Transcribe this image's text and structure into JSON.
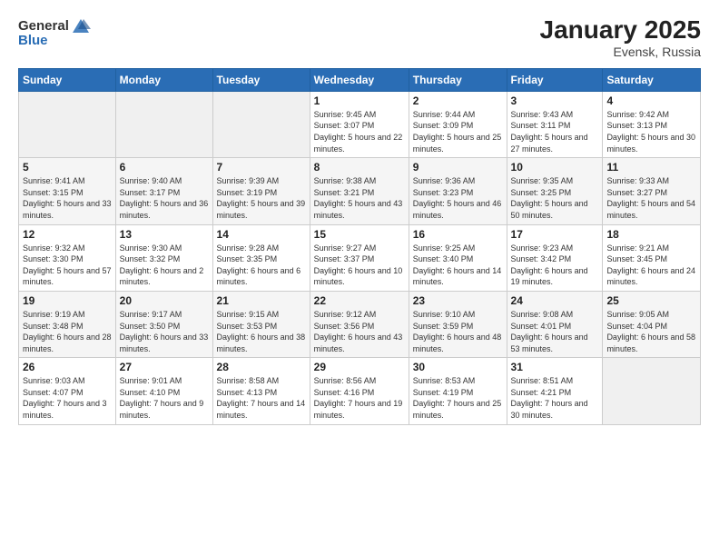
{
  "logo": {
    "general": "General",
    "blue": "Blue"
  },
  "header": {
    "month": "January 2025",
    "location": "Evensk, Russia"
  },
  "weekdays": [
    "Sunday",
    "Monday",
    "Tuesday",
    "Wednesday",
    "Thursday",
    "Friday",
    "Saturday"
  ],
  "weeks": [
    [
      {
        "day": "",
        "info": ""
      },
      {
        "day": "",
        "info": ""
      },
      {
        "day": "",
        "info": ""
      },
      {
        "day": "1",
        "info": "Sunrise: 9:45 AM\nSunset: 3:07 PM\nDaylight: 5 hours and 22 minutes."
      },
      {
        "day": "2",
        "info": "Sunrise: 9:44 AM\nSunset: 3:09 PM\nDaylight: 5 hours and 25 minutes."
      },
      {
        "day": "3",
        "info": "Sunrise: 9:43 AM\nSunset: 3:11 PM\nDaylight: 5 hours and 27 minutes."
      },
      {
        "day": "4",
        "info": "Sunrise: 9:42 AM\nSunset: 3:13 PM\nDaylight: 5 hours and 30 minutes."
      }
    ],
    [
      {
        "day": "5",
        "info": "Sunrise: 9:41 AM\nSunset: 3:15 PM\nDaylight: 5 hours and 33 minutes."
      },
      {
        "day": "6",
        "info": "Sunrise: 9:40 AM\nSunset: 3:17 PM\nDaylight: 5 hours and 36 minutes."
      },
      {
        "day": "7",
        "info": "Sunrise: 9:39 AM\nSunset: 3:19 PM\nDaylight: 5 hours and 39 minutes."
      },
      {
        "day": "8",
        "info": "Sunrise: 9:38 AM\nSunset: 3:21 PM\nDaylight: 5 hours and 43 minutes."
      },
      {
        "day": "9",
        "info": "Sunrise: 9:36 AM\nSunset: 3:23 PM\nDaylight: 5 hours and 46 minutes."
      },
      {
        "day": "10",
        "info": "Sunrise: 9:35 AM\nSunset: 3:25 PM\nDaylight: 5 hours and 50 minutes."
      },
      {
        "day": "11",
        "info": "Sunrise: 9:33 AM\nSunset: 3:27 PM\nDaylight: 5 hours and 54 minutes."
      }
    ],
    [
      {
        "day": "12",
        "info": "Sunrise: 9:32 AM\nSunset: 3:30 PM\nDaylight: 5 hours and 57 minutes."
      },
      {
        "day": "13",
        "info": "Sunrise: 9:30 AM\nSunset: 3:32 PM\nDaylight: 6 hours and 2 minutes."
      },
      {
        "day": "14",
        "info": "Sunrise: 9:28 AM\nSunset: 3:35 PM\nDaylight: 6 hours and 6 minutes."
      },
      {
        "day": "15",
        "info": "Sunrise: 9:27 AM\nSunset: 3:37 PM\nDaylight: 6 hours and 10 minutes."
      },
      {
        "day": "16",
        "info": "Sunrise: 9:25 AM\nSunset: 3:40 PM\nDaylight: 6 hours and 14 minutes."
      },
      {
        "day": "17",
        "info": "Sunrise: 9:23 AM\nSunset: 3:42 PM\nDaylight: 6 hours and 19 minutes."
      },
      {
        "day": "18",
        "info": "Sunrise: 9:21 AM\nSunset: 3:45 PM\nDaylight: 6 hours and 24 minutes."
      }
    ],
    [
      {
        "day": "19",
        "info": "Sunrise: 9:19 AM\nSunset: 3:48 PM\nDaylight: 6 hours and 28 minutes."
      },
      {
        "day": "20",
        "info": "Sunrise: 9:17 AM\nSunset: 3:50 PM\nDaylight: 6 hours and 33 minutes."
      },
      {
        "day": "21",
        "info": "Sunrise: 9:15 AM\nSunset: 3:53 PM\nDaylight: 6 hours and 38 minutes."
      },
      {
        "day": "22",
        "info": "Sunrise: 9:12 AM\nSunset: 3:56 PM\nDaylight: 6 hours and 43 minutes."
      },
      {
        "day": "23",
        "info": "Sunrise: 9:10 AM\nSunset: 3:59 PM\nDaylight: 6 hours and 48 minutes."
      },
      {
        "day": "24",
        "info": "Sunrise: 9:08 AM\nSunset: 4:01 PM\nDaylight: 6 hours and 53 minutes."
      },
      {
        "day": "25",
        "info": "Sunrise: 9:05 AM\nSunset: 4:04 PM\nDaylight: 6 hours and 58 minutes."
      }
    ],
    [
      {
        "day": "26",
        "info": "Sunrise: 9:03 AM\nSunset: 4:07 PM\nDaylight: 7 hours and 3 minutes."
      },
      {
        "day": "27",
        "info": "Sunrise: 9:01 AM\nSunset: 4:10 PM\nDaylight: 7 hours and 9 minutes."
      },
      {
        "day": "28",
        "info": "Sunrise: 8:58 AM\nSunset: 4:13 PM\nDaylight: 7 hours and 14 minutes."
      },
      {
        "day": "29",
        "info": "Sunrise: 8:56 AM\nSunset: 4:16 PM\nDaylight: 7 hours and 19 minutes."
      },
      {
        "day": "30",
        "info": "Sunrise: 8:53 AM\nSunset: 4:19 PM\nDaylight: 7 hours and 25 minutes."
      },
      {
        "day": "31",
        "info": "Sunrise: 8:51 AM\nSunset: 4:21 PM\nDaylight: 7 hours and 30 minutes."
      },
      {
        "day": "",
        "info": ""
      }
    ]
  ]
}
